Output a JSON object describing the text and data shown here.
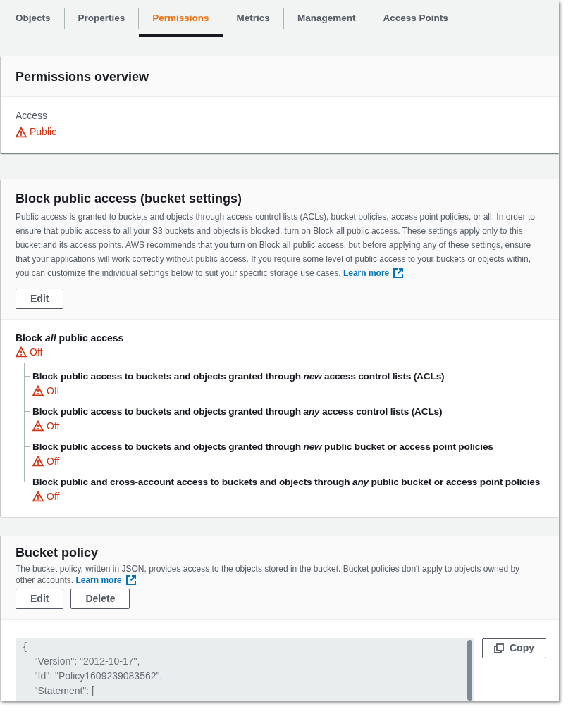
{
  "tabs": [
    {
      "label": "Objects",
      "selected": false
    },
    {
      "label": "Properties",
      "selected": false
    },
    {
      "label": "Permissions",
      "selected": true
    },
    {
      "label": "Metrics",
      "selected": false
    },
    {
      "label": "Management",
      "selected": false
    },
    {
      "label": "Access Points",
      "selected": false
    }
  ],
  "permissions_overview": {
    "title": "Permissions overview",
    "access_label": "Access",
    "access_value": "Public"
  },
  "block_public_access": {
    "title": "Block public access (bucket settings)",
    "description": "Public access is granted to buckets and objects through access control lists (ACLs), bucket policies, access point policies, or all. In order to ensure that public access to all your S3 buckets and objects is blocked, turn on Block all public access. These settings apply only to this bucket and its access points. AWS recommends that you turn on Block all public access, but before applying any of these settings, ensure that your applications will work correctly without public access. If you require some level of public access to your buckets or objects within, you can customize the individual settings below to suit your specific storage use cases.",
    "learn_more": "Learn more",
    "edit_button": "Edit",
    "block_all": {
      "label": "Block *all* public access",
      "status": "Off",
      "on": false,
      "children": [
        {
          "label": "Block public access to buckets and objects granted through *new* access control lists (ACLs)",
          "status": "Off",
          "on": false
        },
        {
          "label": "Block public access to buckets and objects granted through *any* access control lists (ACLs)",
          "status": "Off",
          "on": false
        },
        {
          "label": "Block public access to buckets and objects granted through *new* public bucket or access point policies",
          "status": "Off",
          "on": false
        },
        {
          "label": "Block public and cross-account access to buckets and objects through *any* public bucket or access point policies",
          "status": "Off",
          "on": false
        }
      ]
    }
  },
  "bucket_policy": {
    "title": "Bucket policy",
    "description": "The bucket policy, written in JSON, provides access to the objects stored in the bucket. Bucket policies don't apply to objects owned by other accounts.",
    "learn_more": "Learn more",
    "buttons": [
      "Edit",
      "Delete"
    ],
    "policy_text": "{\n    \"Version\": \"2012-10-17\",\n    \"Id\": \"Policy1609239083562\",\n    \"Statement\": [",
    "copy_button": "Copy"
  }
}
